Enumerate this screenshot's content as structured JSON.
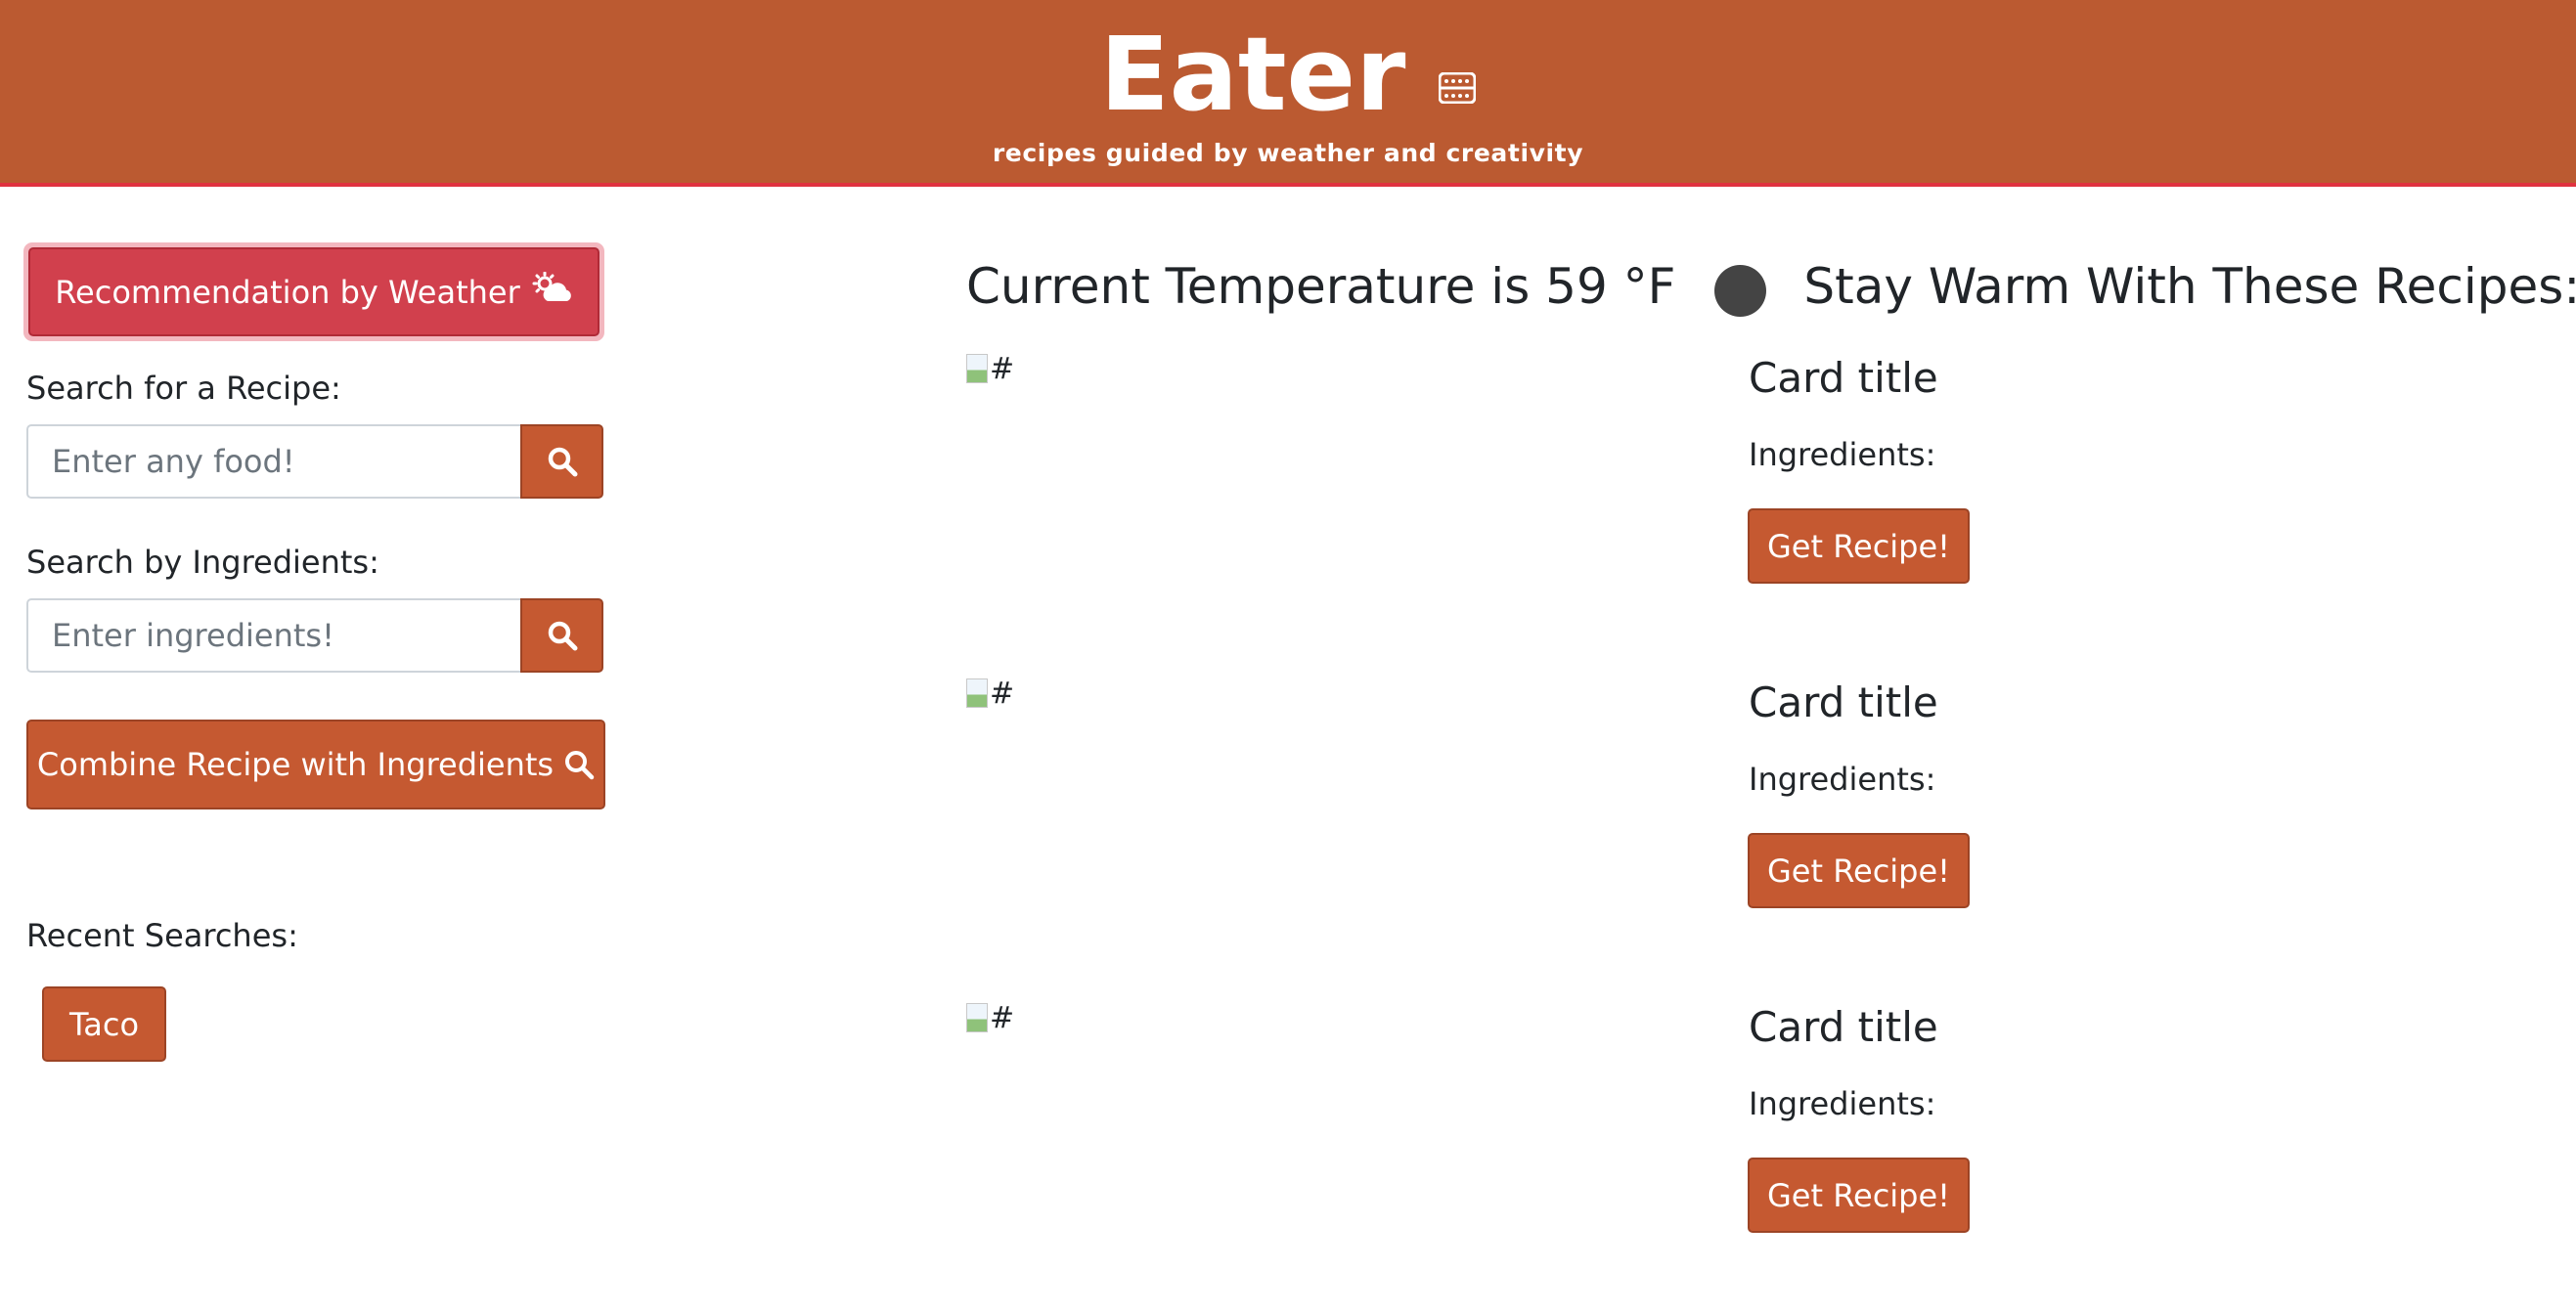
{
  "header": {
    "title": "Eater",
    "tagline": "recipes guided by weather and creativity",
    "icon": "oven-icon"
  },
  "sidebar": {
    "weather_button": "Recommendation by Weather",
    "weather_icon": "cloud-sun-icon",
    "search_recipe_label": "Search for a Recipe:",
    "search_recipe_placeholder": "Enter any food!",
    "search_ingredients_label": "Search by Ingredients:",
    "search_ingredients_placeholder": "Enter ingredients!",
    "combine_button": "Combine Recipe with Ingredients",
    "recent_label": "Recent Searches:",
    "recent_searches": [
      "Taco"
    ]
  },
  "main": {
    "temperature_text": "Current Temperature is 59 °F",
    "headline": "Stay Warm With These Recipes:",
    "cards": [
      {
        "img_alt": "#",
        "title": "Card title",
        "ingredients_label": "Ingredients:",
        "button": "Get Recipe!"
      },
      {
        "img_alt": "#",
        "title": "Card title",
        "ingredients_label": "Ingredients:",
        "button": "Get Recipe!"
      },
      {
        "img_alt": "#",
        "title": "Card title",
        "ingredients_label": "Ingredients:",
        "button": "Get Recipe!"
      }
    ]
  },
  "colors": {
    "brand": "#bb5a31",
    "danger": "#d1404d",
    "header_border": "#e0323f"
  }
}
